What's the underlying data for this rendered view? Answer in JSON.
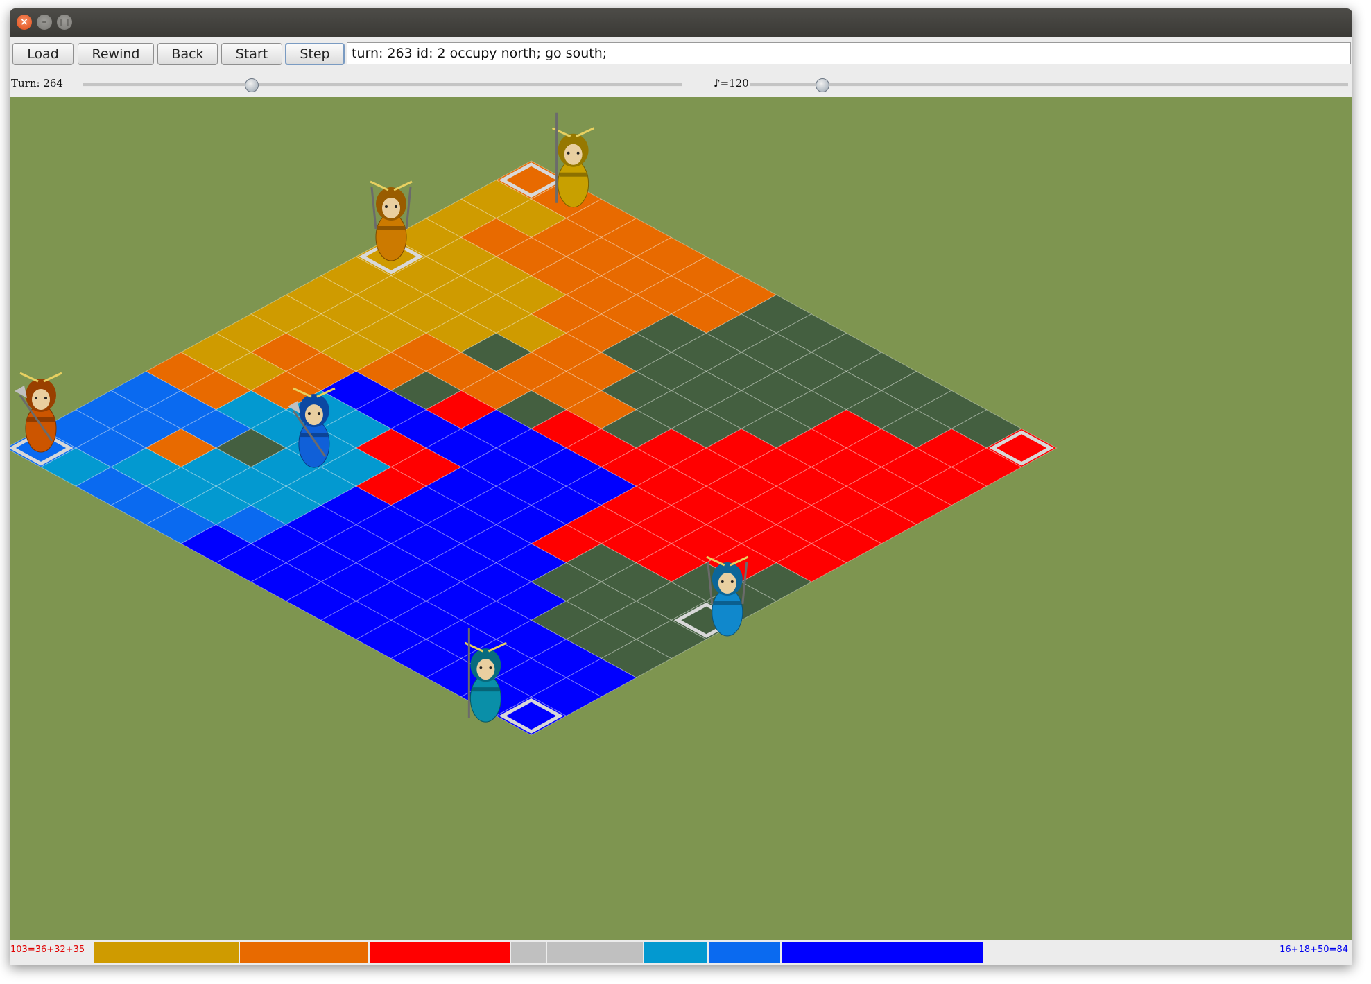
{
  "window": {
    "controls": [
      "close-icon",
      "minimize-icon",
      "maximize-icon"
    ]
  },
  "toolbar": {
    "load_label": "Load",
    "rewind_label": "Rewind",
    "back_label": "Back",
    "start_label": "Start",
    "step_label": "Step",
    "log_text": "turn: 263 id: 2 occupy north; go south;"
  },
  "controls": {
    "turn_label": "Turn: 264",
    "turn_slider_value": 0.28,
    "tempo_label": "♪=120",
    "tempo_slider_value": 0.12
  },
  "status": {
    "left_score": "103=36+32+35",
    "right_score": "16+18+50=84",
    "segments": [
      {
        "team": "gold",
        "value": 36
      },
      {
        "team": "orange",
        "value": 32
      },
      {
        "team": "red",
        "value": 35
      },
      {
        "team": "neutral",
        "value": 9
      },
      {
        "team": "neutral",
        "value": 24
      },
      {
        "team": "cyan",
        "value": 16
      },
      {
        "team": "azure",
        "value": 18
      },
      {
        "team": "blue",
        "value": 50
      }
    ]
  },
  "colors": {
    "field": "#7e9550",
    "gold": "#cf9b00",
    "orange": "#e86a00",
    "red": "#ff0000",
    "neutral": "#445f40",
    "cyan": "#0399d0",
    "azure": "#0a6af0",
    "blue": "#0000ff",
    "statusbar_neutral": "#c0c0c0"
  },
  "board": {
    "legend": {
      "Y": "gold",
      "O": "orange",
      "R": "red",
      "N": "neutral",
      "C": "cyan",
      "A": "azure",
      "B": "blue"
    },
    "rows": [
      "RNNNNNNNOOOOOOO",
      "RRNNNNNNOOOOOYY",
      "RRRRNNNNNOOOOOY",
      "RRRRNNNNNOOYYYY",
      "RRRRRNNNOOYYYYY",
      "RRRRRRNOOONYYYY",
      "RRRRRRRRNOOOYYY",
      "NRRRRBBBBRNOYYY",
      "NNRRRBBBBBBBOOY",
      "NNNNRBBBRRCCOYY",
      "NNNNBBBBRCCCCOO",
      "NNNBBBBBBCCNAAA",
      "BBBBBBBBBCCCOAA",
      "BBBBBBBBBACCCAA",
      "BBBBBBBBBBAAACA"
    ],
    "home_cells": [
      {
        "team": "red"
      },
      {
        "team": "orange"
      },
      {
        "team": "gold"
      },
      {
        "team": "cyan"
      },
      {
        "team": "blue"
      },
      {
        "team": "azure"
      }
    ],
    "samurai": [
      {
        "team": "gold",
        "weapon": "spear"
      },
      {
        "team": "orange",
        "weapon": "swords"
      },
      {
        "team": "red",
        "weapon": "axe"
      },
      {
        "team": "azure",
        "weapon": "swords"
      },
      {
        "team": "cyan",
        "weapon": "spear"
      },
      {
        "team": "blue",
        "weapon": "axe"
      }
    ]
  }
}
